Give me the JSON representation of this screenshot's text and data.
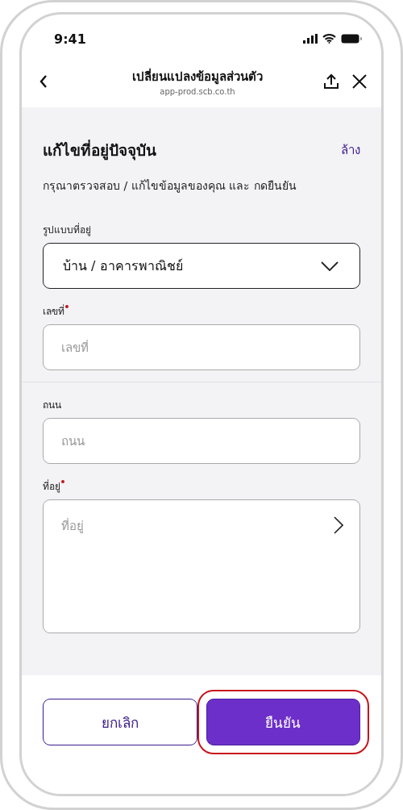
{
  "status_bar": {
    "time": "9:41"
  },
  "header": {
    "title": "เปลี่ยนแปลงข้อมูลส่วนตัว",
    "url": "app-prod.scb.co.th"
  },
  "form": {
    "title": "แก้ไขที่อยู่ปัจจุบัน",
    "clear_link": "ล้าง",
    "subtitle": "กรุณาตรวจสอบ / แก้ไขข้อมูลของคุณ และ กดยืนยัน",
    "fields": [
      {
        "kind": "select",
        "label": "รูปแบบที่อยู่",
        "required": false,
        "value": "บ้าน / อาคารพาณิชย์"
      },
      {
        "kind": "input",
        "label": "เลขที่",
        "required": true,
        "placeholder": "เลขที่",
        "divider_after": true
      },
      {
        "kind": "input",
        "label": "ถนน",
        "required": false,
        "placeholder": "ถนน"
      },
      {
        "kind": "textarea",
        "label": "ที่อยู่",
        "required": true,
        "placeholder": "ที่อยู่"
      }
    ]
  },
  "buttons": [
    {
      "kind": "secondary",
      "label": "ยกเลิก",
      "highlighted": false
    },
    {
      "kind": "primary",
      "label": "ยืนยัน",
      "highlighted": true
    }
  ]
}
